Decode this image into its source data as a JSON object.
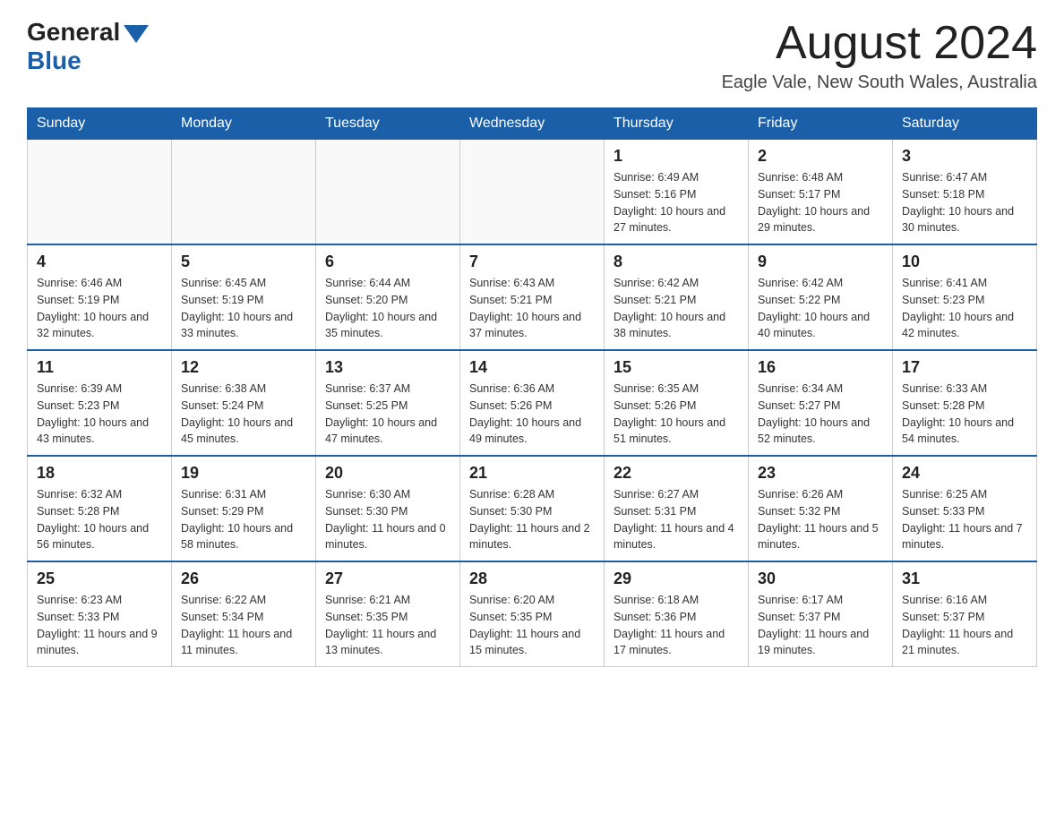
{
  "header": {
    "logo_general": "General",
    "logo_blue": "Blue",
    "month_title": "August 2024",
    "location": "Eagle Vale, New South Wales, Australia"
  },
  "weekdays": [
    "Sunday",
    "Monday",
    "Tuesday",
    "Wednesday",
    "Thursday",
    "Friday",
    "Saturday"
  ],
  "weeks": [
    [
      {
        "day": "",
        "info": ""
      },
      {
        "day": "",
        "info": ""
      },
      {
        "day": "",
        "info": ""
      },
      {
        "day": "",
        "info": ""
      },
      {
        "day": "1",
        "info": "Sunrise: 6:49 AM\nSunset: 5:16 PM\nDaylight: 10 hours and 27 minutes."
      },
      {
        "day": "2",
        "info": "Sunrise: 6:48 AM\nSunset: 5:17 PM\nDaylight: 10 hours and 29 minutes."
      },
      {
        "day": "3",
        "info": "Sunrise: 6:47 AM\nSunset: 5:18 PM\nDaylight: 10 hours and 30 minutes."
      }
    ],
    [
      {
        "day": "4",
        "info": "Sunrise: 6:46 AM\nSunset: 5:19 PM\nDaylight: 10 hours and 32 minutes."
      },
      {
        "day": "5",
        "info": "Sunrise: 6:45 AM\nSunset: 5:19 PM\nDaylight: 10 hours and 33 minutes."
      },
      {
        "day": "6",
        "info": "Sunrise: 6:44 AM\nSunset: 5:20 PM\nDaylight: 10 hours and 35 minutes."
      },
      {
        "day": "7",
        "info": "Sunrise: 6:43 AM\nSunset: 5:21 PM\nDaylight: 10 hours and 37 minutes."
      },
      {
        "day": "8",
        "info": "Sunrise: 6:42 AM\nSunset: 5:21 PM\nDaylight: 10 hours and 38 minutes."
      },
      {
        "day": "9",
        "info": "Sunrise: 6:42 AM\nSunset: 5:22 PM\nDaylight: 10 hours and 40 minutes."
      },
      {
        "day": "10",
        "info": "Sunrise: 6:41 AM\nSunset: 5:23 PM\nDaylight: 10 hours and 42 minutes."
      }
    ],
    [
      {
        "day": "11",
        "info": "Sunrise: 6:39 AM\nSunset: 5:23 PM\nDaylight: 10 hours and 43 minutes."
      },
      {
        "day": "12",
        "info": "Sunrise: 6:38 AM\nSunset: 5:24 PM\nDaylight: 10 hours and 45 minutes."
      },
      {
        "day": "13",
        "info": "Sunrise: 6:37 AM\nSunset: 5:25 PM\nDaylight: 10 hours and 47 minutes."
      },
      {
        "day": "14",
        "info": "Sunrise: 6:36 AM\nSunset: 5:26 PM\nDaylight: 10 hours and 49 minutes."
      },
      {
        "day": "15",
        "info": "Sunrise: 6:35 AM\nSunset: 5:26 PM\nDaylight: 10 hours and 51 minutes."
      },
      {
        "day": "16",
        "info": "Sunrise: 6:34 AM\nSunset: 5:27 PM\nDaylight: 10 hours and 52 minutes."
      },
      {
        "day": "17",
        "info": "Sunrise: 6:33 AM\nSunset: 5:28 PM\nDaylight: 10 hours and 54 minutes."
      }
    ],
    [
      {
        "day": "18",
        "info": "Sunrise: 6:32 AM\nSunset: 5:28 PM\nDaylight: 10 hours and 56 minutes."
      },
      {
        "day": "19",
        "info": "Sunrise: 6:31 AM\nSunset: 5:29 PM\nDaylight: 10 hours and 58 minutes."
      },
      {
        "day": "20",
        "info": "Sunrise: 6:30 AM\nSunset: 5:30 PM\nDaylight: 11 hours and 0 minutes."
      },
      {
        "day": "21",
        "info": "Sunrise: 6:28 AM\nSunset: 5:30 PM\nDaylight: 11 hours and 2 minutes."
      },
      {
        "day": "22",
        "info": "Sunrise: 6:27 AM\nSunset: 5:31 PM\nDaylight: 11 hours and 4 minutes."
      },
      {
        "day": "23",
        "info": "Sunrise: 6:26 AM\nSunset: 5:32 PM\nDaylight: 11 hours and 5 minutes."
      },
      {
        "day": "24",
        "info": "Sunrise: 6:25 AM\nSunset: 5:33 PM\nDaylight: 11 hours and 7 minutes."
      }
    ],
    [
      {
        "day": "25",
        "info": "Sunrise: 6:23 AM\nSunset: 5:33 PM\nDaylight: 11 hours and 9 minutes."
      },
      {
        "day": "26",
        "info": "Sunrise: 6:22 AM\nSunset: 5:34 PM\nDaylight: 11 hours and 11 minutes."
      },
      {
        "day": "27",
        "info": "Sunrise: 6:21 AM\nSunset: 5:35 PM\nDaylight: 11 hours and 13 minutes."
      },
      {
        "day": "28",
        "info": "Sunrise: 6:20 AM\nSunset: 5:35 PM\nDaylight: 11 hours and 15 minutes."
      },
      {
        "day": "29",
        "info": "Sunrise: 6:18 AM\nSunset: 5:36 PM\nDaylight: 11 hours and 17 minutes."
      },
      {
        "day": "30",
        "info": "Sunrise: 6:17 AM\nSunset: 5:37 PM\nDaylight: 11 hours and 19 minutes."
      },
      {
        "day": "31",
        "info": "Sunrise: 6:16 AM\nSunset: 5:37 PM\nDaylight: 11 hours and 21 minutes."
      }
    ]
  ]
}
